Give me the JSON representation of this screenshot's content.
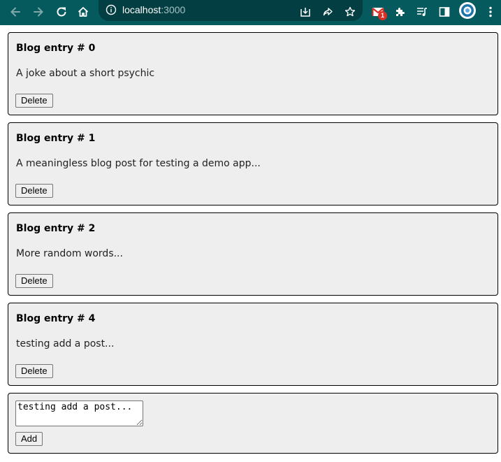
{
  "browser": {
    "url_host": "localhost",
    "url_port": ":3000",
    "mail_badge_count": "1",
    "colors": {
      "toolbar": "#055a5e",
      "omnibox": "#033e42"
    }
  },
  "posts": [
    {
      "title": "Blog entry # 0",
      "body": "A joke about a short psychic",
      "delete_label": "Delete"
    },
    {
      "title": "Blog entry # 1",
      "body": "A meaningless blog post for testing a demo app...",
      "delete_label": "Delete"
    },
    {
      "title": "Blog entry # 2",
      "body": "More random words...",
      "delete_label": "Delete"
    },
    {
      "title": "Blog entry # 4",
      "body": "testing add a post...",
      "delete_label": "Delete"
    }
  ],
  "new_post": {
    "value": "testing add a post...",
    "add_label": "Add"
  },
  "icons": [
    "back-arrow-icon",
    "forward-arrow-icon",
    "reload-icon",
    "home-icon",
    "info-icon",
    "install-icon",
    "share-icon",
    "bookmark-star-icon",
    "gmail-icon",
    "extensions-puzzle-icon",
    "reading-list-icon",
    "side-panel-icon",
    "profile-avatar-icon",
    "kebab-menu-icon"
  ]
}
